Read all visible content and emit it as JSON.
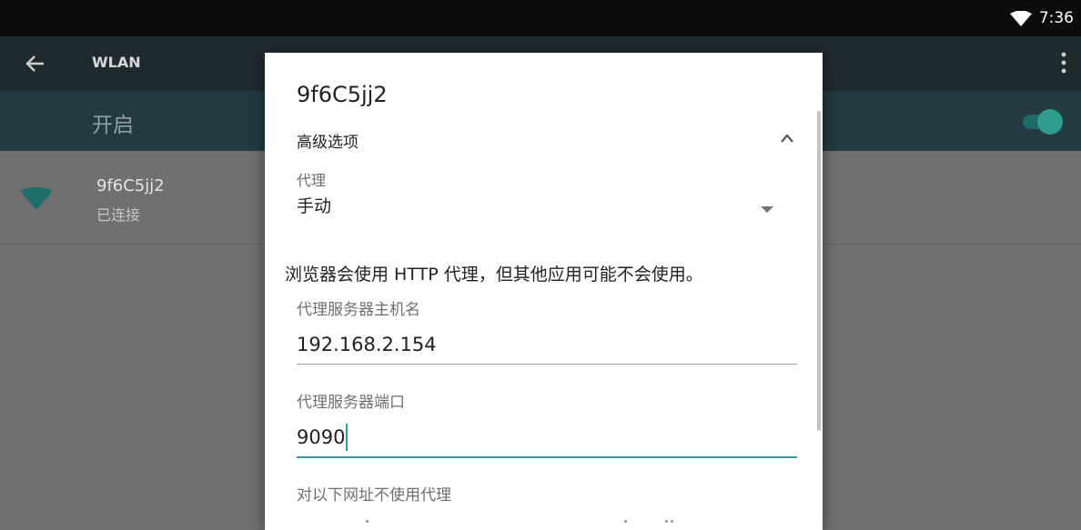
{
  "status_bar": {
    "time": "7:36",
    "icon": "wifi-signal-icon"
  },
  "app_bar": {
    "back_icon": "arrow-left-icon",
    "title": "WLAN",
    "menu_icon": "more-vert-icon"
  },
  "wlan_switch": {
    "label": "开启",
    "enabled": true
  },
  "networks": [
    {
      "name": "9f6C5jj2",
      "status": "已连接",
      "icon": "wifi-icon"
    }
  ],
  "dialog": {
    "title": "9f6C5jj2",
    "advanced_label": "高级选项",
    "advanced_icon": "chevron-up-icon",
    "proxy_label": "代理",
    "proxy_value": "手动",
    "proxy_note": "浏览器会使用 HTTP 代理，但其他应用可能不会使用。",
    "host_label": "代理服务器主机名",
    "host_value": "192.168.2.154",
    "port_label": "代理服务器端口",
    "port_value": "9090",
    "bypass_label": "对以下网址不使用代理"
  },
  "colors": {
    "accent": "#26a69a",
    "app_bar": "#1f2a2e",
    "switch_bar": "#223a40"
  }
}
